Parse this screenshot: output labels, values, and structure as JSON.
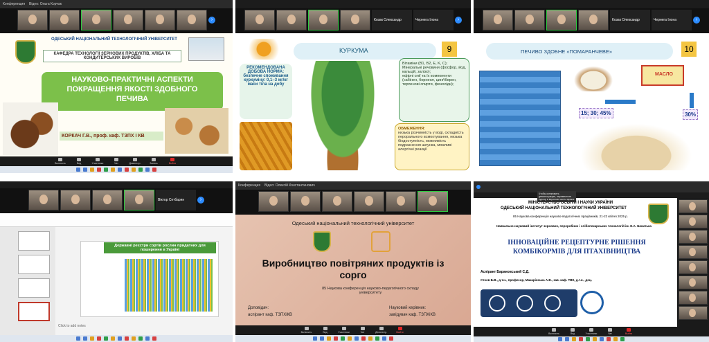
{
  "tile1": {
    "topbar": [
      "Конференция",
      "Відео: Ольга Корчак"
    ],
    "participants": [
      "",
      "",
      "",
      "",
      "",
      ""
    ],
    "slide": {
      "university": "ОДЕСЬКИЙ НАЦІОНАЛЬНИЙ ТЕХНОЛОГІЧНИЙ УНІВЕРСИТЕТ",
      "department": "КАФЕДРА ТЕХНОЛОГІЇ ЗЕРНОВИХ ПРОДУКТІВ, ХЛІБА ТА КОНДИТЕРСЬКИХ ВИРОБІВ",
      "title": "НАУКОВО-ПРАКТИЧНІ АСПЕКТИ ПОКРАЩЕННЯ ЯКОСТІ ЗДОБНОГО ПЕЧИВА",
      "author": "КОРКАЧ Г.В., проф. каф. ТЗПХ І КВ"
    }
  },
  "tile2": {
    "participants": [
      "",
      "",
      "",
      ""
    ],
    "names": [
      "Козак Олександр",
      "Чернега Ілона"
    ],
    "slide": {
      "number": "9",
      "heading": "КУРКУМА",
      "norm": "РЕКОМЕНДОВАНА ДОБОВА НОРМА: безпечне споживання куркуміну: 0,1–3 мг/кг маси тіла на добу",
      "benefits": [
        "Вітаміни (B1, B2, E, K, C);",
        "Мінеральні речовини (фосфор, йод, кальцій, залізо);",
        "ефірні олії та їх компоненти (сабінен, борнеол, цинґіберен, терпенові спирти, феноліди);"
      ],
      "limits_title": "ОБМЕЖЕННЯ:",
      "limits": "низька розчинність у воді, складність перорального всмоктування, низька біодоступність, можливість подразнення шлунка, можливі алергічні реакції"
    }
  },
  "tile3": {
    "participants": [
      "",
      "",
      "",
      ""
    ],
    "names": [
      "Козак Олександр",
      "Чернега Ілона"
    ],
    "slide": {
      "number": "10",
      "heading": "ПЕЧИВО ЗДОБНЕ «ПОМАРАНЧЕВЕ»",
      "butter": "МАСЛО",
      "left_value": "15; 30; 45%",
      "right_value": "30%"
    }
  },
  "tile4": {
    "participants": [
      "",
      "",
      "",
      ""
    ],
    "names": [
      "Віктор Сетбарян"
    ],
    "slide_title": "Державні реєстри сортів рослин придатних для поширення в Україні",
    "notes": "Click to add notes"
  },
  "tile5": {
    "topbar": [
      "Конференция",
      "Відео: Олексій Константинович"
    ],
    "participants": [
      "",
      "",
      "",
      "",
      "",
      ""
    ],
    "slide": {
      "university": "Одеський національний технологічний університет",
      "title": "Виробництво повітряних продуктів із сорго",
      "conference": "85 Наукова конференція науково-педагогічного складу університету",
      "speaker_role": "Доповідач:",
      "speaker": "аспірант каф. ТЗПХіКВ",
      "advisor_role": "Науковий керівник:",
      "advisor": "завідувач каф. ТЗПХіКВ"
    }
  },
  "tile6": {
    "tooltip": "Чтобы остановить демонстрацию, переместите курсор в верхнюю часть экрана",
    "slide": {
      "ministry": "МІНІСТЕРСТВО ОСВІТИ І НАУКИ УКРАЇНИ",
      "university": "ОДЕСЬКИЙ НАЦІОНАЛЬНИЙ ТЕХНОЛОГІЧНИЙ УНІВЕРСИТЕТ",
      "conference": "85 Наукова конференція науково-педагогічних працівників, 21-22 квітня 2025 р.",
      "institute": "Навчально-науковий інститут зернових, переробних і хлібопекарських технологій ім. Е.А. Бокитька",
      "title": "ІННОВАЦІЙНЕ РЕЦЕПТУРНЕ РІШЕННЯ КОМБІКОРМІВ ДЛЯ ПТАХІВНИЦТВА",
      "author": "Аспірант  Барановський С.Д.",
      "coauthors": "Стоєв Б.В., д.т.н., професор, Макарінська А.В., зав. каф. ТВК, д.т.н., доц."
    },
    "side_participants": [
      "",
      "",
      "",
      "",
      "",
      "",
      "",
      ""
    ]
  }
}
